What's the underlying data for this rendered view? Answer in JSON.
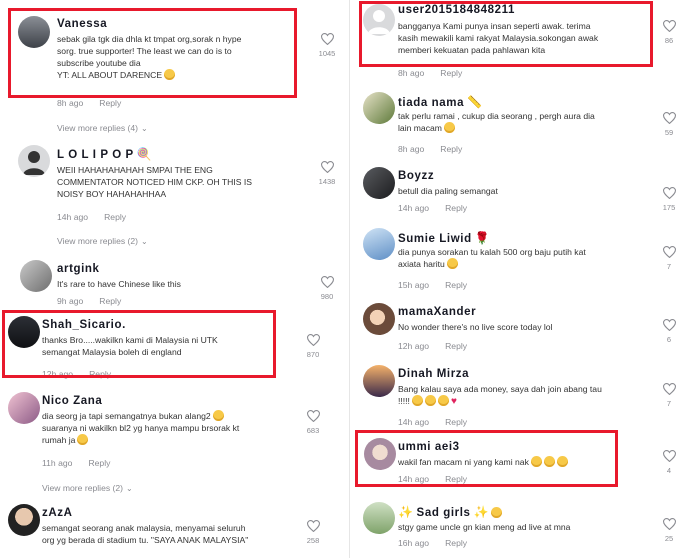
{
  "meta": {
    "reply": "Reply",
    "view_more": "View more replies"
  },
  "left": [
    {
      "user": "Vanessa",
      "text": [
        "sebak gila tgk dia dhla kt tmpat org,sorak n hype",
        "sorg. true supporter! The least we can do is to",
        "subscribe youtube dia",
        "YT: ALL ABOUT DARENCE"
      ],
      "time": "8h ago",
      "likes": "1045",
      "view_more": "View more replies (4)"
    },
    {
      "user": "L O L I P O P",
      "text": [
        "WEII HAHAHAHAHAH SMPAI THE ENG",
        "COMMENTATOR NOTICED HIM CKP. OH THIS IS",
        "NOISY BOY HAHAHAHHAA"
      ],
      "time": "14h ago",
      "likes": "1438",
      "view_more": "View more replies (2)"
    },
    {
      "user": "artgink",
      "text": [
        "It's rare to have Chinese like this"
      ],
      "time": "9h ago",
      "likes": "980"
    },
    {
      "user": "Shah_Sicario.",
      "text": [
        "thanks Bro.....wakilkn kami di Malaysia ni UTK",
        "semangat Malaysia boleh di england"
      ],
      "time": "12h ago",
      "likes": "870"
    },
    {
      "user": "Nico Zana",
      "text": [
        "dia seorg ja tapi semangatnya bukan alang2",
        "suaranya ni wakilkn bl2 yg hanya mampu brsorak kt",
        "rumah ja"
      ],
      "time": "11h ago",
      "likes": "683",
      "view_more": "View more replies (2)"
    },
    {
      "user": "zAzA",
      "text": [
        "semangat seorang anak malaysia, menyamai seluruh",
        "org yg berada di stadium tu. \"SAYA ANAK MALAYSIA\""
      ],
      "time": "",
      "likes": "258"
    }
  ],
  "right": [
    {
      "user": "user2015184848211",
      "text": [
        "bangganya Kami punya insan seperti awak. terima",
        "kasih mewakili kami rakyat Malaysia.sokongan awak",
        "memberi kekuatan pada pahlawan kita"
      ],
      "time": "8h ago",
      "likes": "86"
    },
    {
      "user": "tiada nama",
      "text": [
        "tak perlu ramai , cukup dia seorang , pergh aura dia",
        "lain macam"
      ],
      "time": "8h ago",
      "likes": "59"
    },
    {
      "user": "Boyzz",
      "text": [
        "betull dia paling semangat"
      ],
      "time": "14h ago",
      "likes": "175"
    },
    {
      "user": "Sumie Liwid",
      "text": [
        "dia punya sorakan tu kalah 500 org baju putih kat",
        "axiata haritu"
      ],
      "time": "15h ago",
      "likes": "7"
    },
    {
      "user": "mamaXander",
      "text": [
        "No wonder there's no live score today lol"
      ],
      "time": "12h ago",
      "likes": "6"
    },
    {
      "user": "Dinah Mirza",
      "text": [
        "Bang kalau saya ada money, saya dah join abang tau",
        "!!!!!"
      ],
      "time": "14h ago",
      "likes": "7"
    },
    {
      "user": "ummi aei3",
      "text": [
        "wakil fan macam ni yang kami nak"
      ],
      "time": "14h ago",
      "likes": "4"
    },
    {
      "user": "Sad girls",
      "text": [
        "stgy game uncle gn kian meng ad live at mna"
      ],
      "time": "16h ago",
      "likes": "25"
    }
  ],
  "colors": {
    "highlight": "#e8192c",
    "muted": "#8a8b91",
    "text": "#161823"
  }
}
